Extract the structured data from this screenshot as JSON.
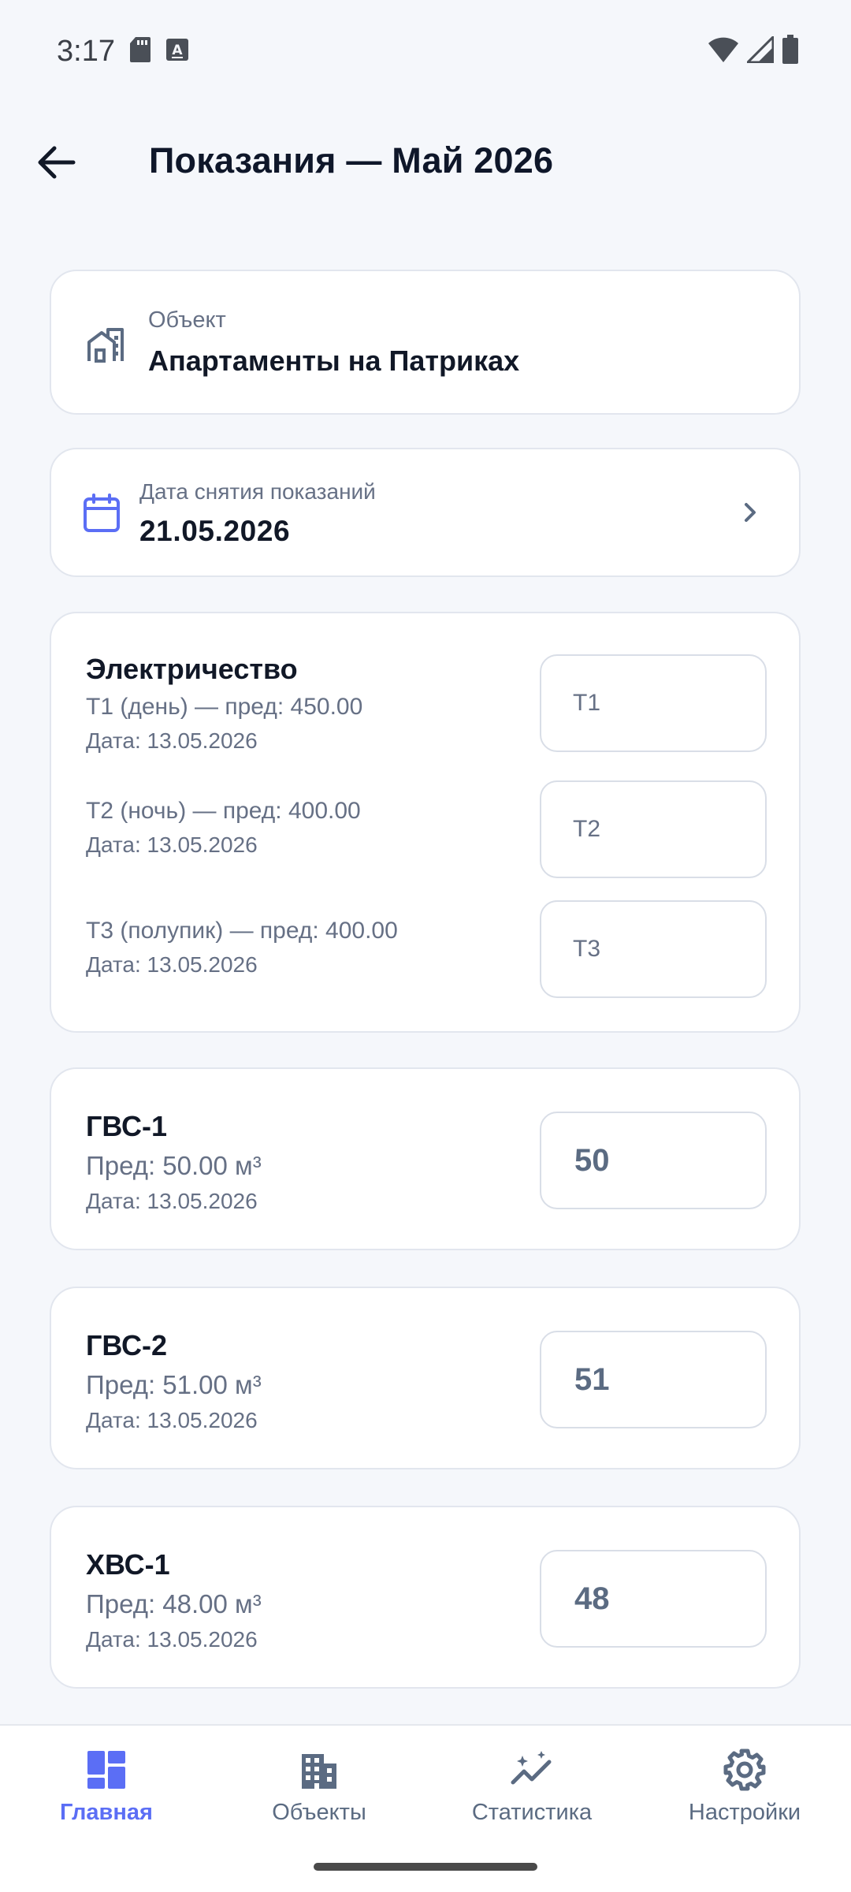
{
  "status_bar": {
    "time": "3:17",
    "icons": [
      "sd-card-icon",
      "keyboard-a-icon",
      "wifi-icon",
      "signal-icon",
      "battery-icon"
    ]
  },
  "app_bar": {
    "back_icon": "arrow-left-icon",
    "title": "Показания — Май 2026"
  },
  "object_card": {
    "icon": "buildings-icon",
    "label": "Объект",
    "name": "Апартаменты на Патриках"
  },
  "date_card": {
    "icon": "calendar-icon",
    "label": "Дата снятия показаний",
    "value": "21.05.2026",
    "chevron_icon": "chevron-right-icon"
  },
  "meters": {
    "electricity": {
      "title": "Электричество",
      "tariffs": [
        {
          "label": "Т1 (день) — пред: 450.00",
          "date": "Дата: 13.05.2026",
          "placeholder": "Т1"
        },
        {
          "label": "Т2 (ночь) — пред: 400.00",
          "date": "Дата: 13.05.2026",
          "placeholder": "Т2"
        },
        {
          "label": "Т3 (полупик) — пред: 400.00",
          "date": "Дата: 13.05.2026",
          "placeholder": "Т3"
        }
      ]
    },
    "gvs1": {
      "title": "ГВС-1",
      "prev": "Пред: 50.00 м³",
      "date": "Дата: 13.05.2026",
      "value": "50"
    },
    "gvs2": {
      "title": "ГВС-2",
      "prev": "Пред: 51.00 м³",
      "date": "Дата: 13.05.2026",
      "value": "51"
    },
    "hvs1": {
      "title": "ХВС-1",
      "prev": "Пред: 48.00 м³",
      "date": "Дата: 13.05.2026",
      "value": "48"
    }
  },
  "bottom_nav": {
    "items": [
      {
        "label": "Главная",
        "icon": "dashboard-icon",
        "active": true
      },
      {
        "label": "Объекты",
        "icon": "building-icon",
        "active": false
      },
      {
        "label": "Статистика",
        "icon": "stats-icon",
        "active": false
      },
      {
        "label": "Настройки",
        "icon": "settings-gear-icon",
        "active": false
      }
    ]
  },
  "colors": {
    "accent": "#5B6EF5",
    "background": "#F5F7FB",
    "card": "#FFFFFF",
    "muted_text": "#667085",
    "input_value": "#5B6B82"
  }
}
